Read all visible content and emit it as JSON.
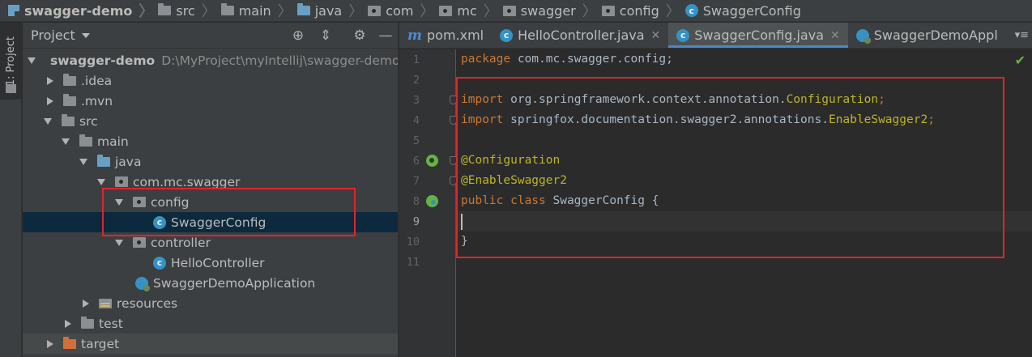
{
  "breadcrumb": {
    "items": [
      "swagger-demo",
      "src",
      "main",
      "java",
      "com",
      "mc",
      "swagger",
      "config",
      "SwaggerConfig"
    ]
  },
  "left_strip": {
    "project_tab": "1: Project"
  },
  "project_panel": {
    "title": "Project",
    "tree": [
      {
        "label": "swagger-demo",
        "path": "D:\\MyProject\\myIntellij\\swagger-demo"
      },
      {
        "label": ".idea"
      },
      {
        "label": ".mvn"
      },
      {
        "label": "src"
      },
      {
        "label": "main"
      },
      {
        "label": "java"
      },
      {
        "label": "com.mc.swagger"
      },
      {
        "label": "config"
      },
      {
        "label": "SwaggerConfig"
      },
      {
        "label": "controller"
      },
      {
        "label": "HelloController"
      },
      {
        "label": "SwaggerDemoApplication"
      },
      {
        "label": "resources"
      },
      {
        "label": "test"
      },
      {
        "label": "target"
      }
    ]
  },
  "editor": {
    "tabs": [
      {
        "label": "pom.xml"
      },
      {
        "label": "HelloController.java"
      },
      {
        "label": "SwaggerConfig.java"
      },
      {
        "label": "SwaggerDemoAppl"
      }
    ],
    "overflow": "▾≡",
    "line_numbers": [
      "1",
      "2",
      "3",
      "4",
      "5",
      "6",
      "7",
      "8",
      "9",
      "10",
      "11"
    ],
    "code": {
      "l1_kw": "package",
      "l1_rest": " com.mc.swagger.config;",
      "l3_kw": "import",
      "l3_rest": " org.springframework.context.annotation.",
      "l3_cls": "Configuration",
      "l3_end": ";",
      "l4_kw": "import",
      "l4_rest": " springfox.documentation.swagger2.annotations.",
      "l4_cls": "EnableSwagger2",
      "l4_end": ";",
      "l6_ann": "@Configuration",
      "l7_ann": "@EnableSwagger2",
      "l8_kw": "public class",
      "l8_rest": " SwaggerConfig {",
      "l10": "}"
    }
  },
  "colors": {
    "highlight": "#e0242d",
    "keyword": "#cc7832",
    "annotation": "#bbb529",
    "selection": "#0d293e"
  }
}
